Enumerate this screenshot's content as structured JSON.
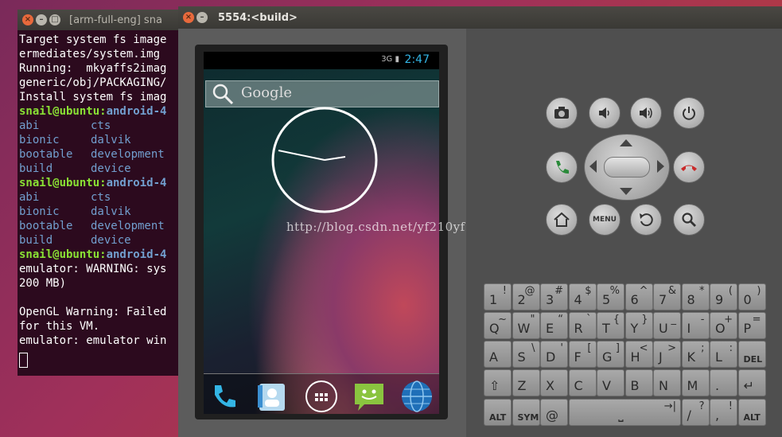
{
  "terminal": {
    "title": "[arm-full-eng] sna",
    "lines": [
      {
        "type": "plain",
        "text": "Target system fs image"
      },
      {
        "type": "plain",
        "text": "ermediates/system.img"
      },
      {
        "type": "plain",
        "text": "Running:  mkyaffs2imag"
      },
      {
        "type": "plain",
        "text": "generic/obj/PACKAGING/"
      },
      {
        "type": "plain",
        "text": "Install system fs imag"
      },
      {
        "type": "prompt",
        "user": "snail@ubuntu:",
        "path": "android-4"
      },
      {
        "type": "cols",
        "a": "abi",
        "b": "cts"
      },
      {
        "type": "cols",
        "a": "bionic",
        "b": "dalvik"
      },
      {
        "type": "cols",
        "a": "bootable",
        "b": "development"
      },
      {
        "type": "cols",
        "a": "build",
        "b": "device"
      },
      {
        "type": "prompt",
        "user": "snail@ubuntu:",
        "path": "android-4"
      },
      {
        "type": "cols",
        "a": "abi",
        "b": "cts"
      },
      {
        "type": "cols",
        "a": "bionic",
        "b": "dalvik"
      },
      {
        "type": "cols",
        "a": "bootable",
        "b": "development"
      },
      {
        "type": "cols",
        "a": "build",
        "b": "device"
      },
      {
        "type": "prompt",
        "user": "snail@ubuntu:",
        "path": "android-4"
      },
      {
        "type": "plain",
        "text": "emulator: WARNING: sys"
      },
      {
        "type": "plain",
        "text": "200 MB)"
      },
      {
        "type": "plain",
        "text": ""
      },
      {
        "type": "plain",
        "text": "OpenGL Warning: Failed"
      },
      {
        "type": "plain",
        "text": "for this VM."
      },
      {
        "type": "plain",
        "text": "emulator: emulator win"
      }
    ]
  },
  "emulator": {
    "title": "5554:<build>",
    "status_time": "2:47",
    "status_network": "3G",
    "search_label": "Google",
    "watermark": "http://blog.csdn.net/yf210yf",
    "colors": {
      "accent": "#33b5e5",
      "key": "#9d9d9d"
    },
    "controls": [
      {
        "name": "camera-icon"
      },
      {
        "name": "volume-down-icon"
      },
      {
        "name": "volume-up-icon"
      },
      {
        "name": "power-icon"
      },
      {
        "name": "call-icon"
      },
      {
        "name": "dpad"
      },
      {
        "name": "end-call-icon"
      },
      {
        "name": "home-icon"
      },
      {
        "name": "menu-button",
        "label": "MENU"
      },
      {
        "name": "back-icon"
      },
      {
        "name": "search-icon"
      }
    ],
    "keyboard": [
      [
        {
          "m": "1",
          "s": "!"
        },
        {
          "m": "2",
          "s": "@"
        },
        {
          "m": "3",
          "s": "#"
        },
        {
          "m": "4",
          "s": "$"
        },
        {
          "m": "5",
          "s": "%"
        },
        {
          "m": "6",
          "s": "^"
        },
        {
          "m": "7",
          "s": "&"
        },
        {
          "m": "8",
          "s": "*"
        },
        {
          "m": "9",
          "s": "("
        },
        {
          "m": "0",
          "s": ")"
        }
      ],
      [
        {
          "m": "Q",
          "s": "~"
        },
        {
          "m": "W",
          "s": "\""
        },
        {
          "m": "E",
          "s": "“"
        },
        {
          "m": "R",
          "s": "`"
        },
        {
          "m": "T",
          "s": "{"
        },
        {
          "m": "Y",
          "s": "}"
        },
        {
          "m": "U",
          "s": "_"
        },
        {
          "m": "I",
          "s": "-"
        },
        {
          "m": "O",
          "s": "+"
        },
        {
          "m": "P",
          "s": "="
        }
      ],
      [
        {
          "m": "A",
          "s": ""
        },
        {
          "m": "S",
          "s": "\\"
        },
        {
          "m": "D",
          "s": "'"
        },
        {
          "m": "F",
          "s": "["
        },
        {
          "m": "G",
          "s": "]"
        },
        {
          "m": "H",
          "s": "<"
        },
        {
          "m": "J",
          "s": ">"
        },
        {
          "m": "K",
          "s": ";"
        },
        {
          "m": "L",
          "s": ":"
        },
        {
          "m": "DEL",
          "s": ""
        }
      ],
      [
        {
          "m": "⇧",
          "s": ""
        },
        {
          "m": "Z",
          "s": ""
        },
        {
          "m": "X",
          "s": ""
        },
        {
          "m": "C",
          "s": ""
        },
        {
          "m": "V",
          "s": ""
        },
        {
          "m": "B",
          "s": ""
        },
        {
          "m": "N",
          "s": ""
        },
        {
          "m": "M",
          "s": ""
        },
        {
          "m": ".",
          "s": ""
        },
        {
          "m": "↵",
          "s": ""
        }
      ],
      [
        {
          "m": "ALT",
          "s": ""
        },
        {
          "m": "SYM",
          "s": ""
        },
        {
          "m": "@",
          "s": ""
        },
        {
          "m": "⎵",
          "s": "→|"
        },
        {
          "m": "/",
          "s": "?"
        },
        {
          "m": ",",
          "s": "!"
        },
        {
          "m": "ALT",
          "s": ""
        }
      ]
    ]
  }
}
